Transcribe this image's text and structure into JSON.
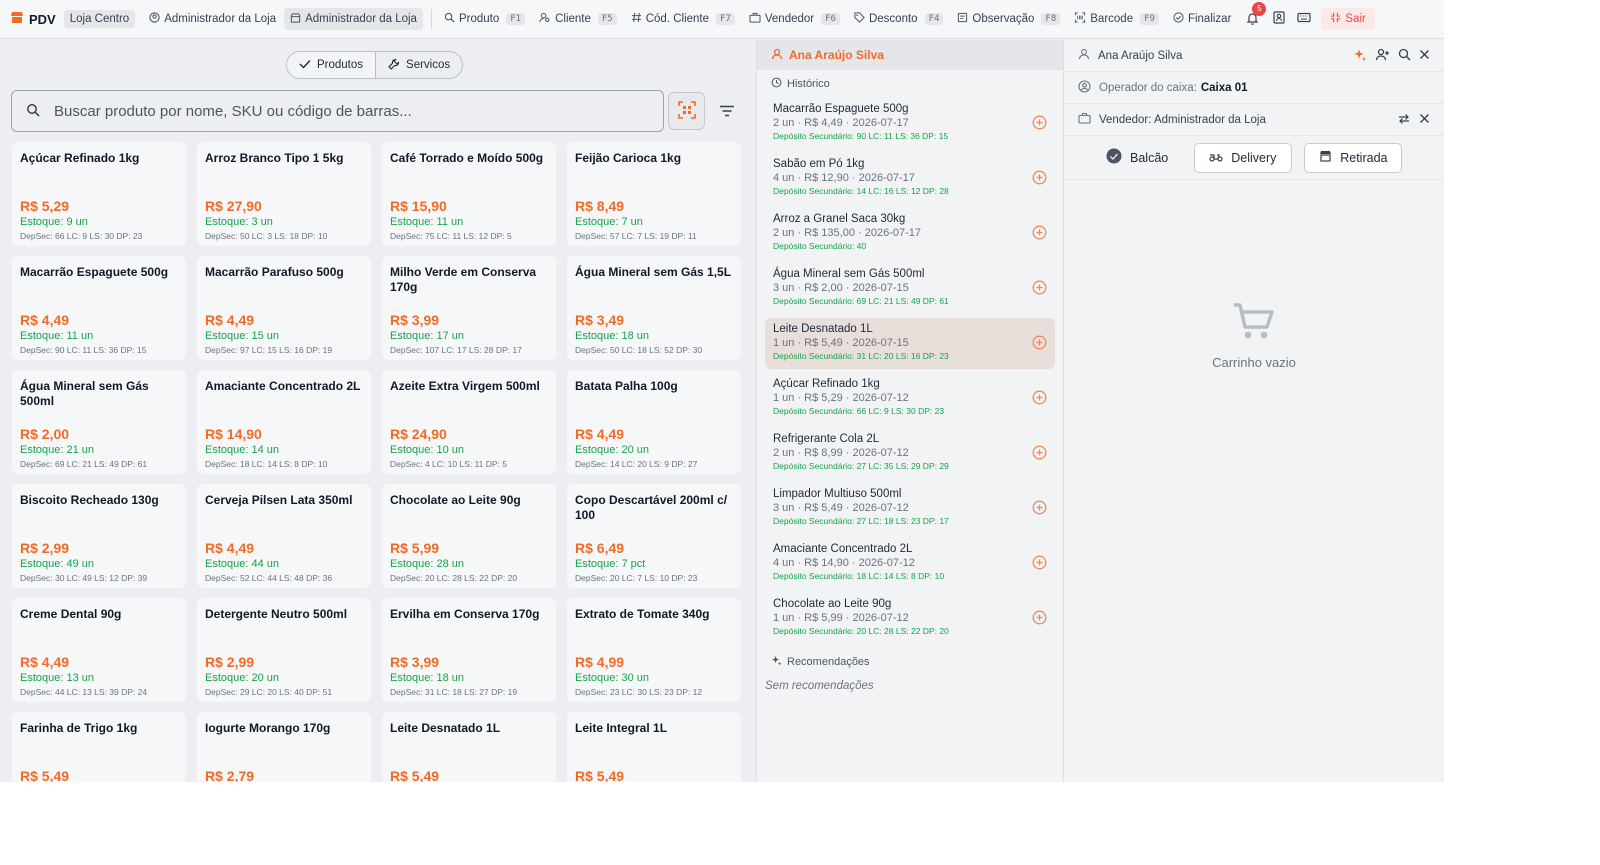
{
  "colors": {
    "accent": "#f06b26",
    "stock": "#16a34a",
    "danger": "#ef4444"
  },
  "topbar": {
    "brand": "PDV",
    "store": "Loja Centro",
    "items": [
      {
        "label": "Administrador da Loja",
        "icon": "user-circle-icon",
        "key": ""
      },
      {
        "label": "Administrador da Loja",
        "icon": "store-icon",
        "key": ""
      },
      {
        "label": "Produto",
        "icon": "search-icon",
        "key": "F1"
      },
      {
        "label": "Cliente",
        "icon": "user-search-icon",
        "key": "F5"
      },
      {
        "label": "Cód. Cliente",
        "icon": "hash-icon",
        "key": "F7"
      },
      {
        "label": "Vendedor",
        "icon": "briefcase-icon",
        "key": "F6"
      },
      {
        "label": "Desconto",
        "icon": "tag-icon",
        "key": "F4"
      },
      {
        "label": "Observação",
        "icon": "note-icon",
        "key": "F8"
      },
      {
        "label": "Barcode",
        "icon": "barcode-scan-icon",
        "key": "F9"
      },
      {
        "label": "Finalizar",
        "icon": "check-circle-icon",
        "key": ""
      }
    ],
    "notifications": "5",
    "exit_label": "Sair"
  },
  "tabs": {
    "products": "Produtos",
    "services": "Servicos"
  },
  "search": {
    "placeholder": "Buscar produto por nome, SKU ou código de barras..."
  },
  "products": [
    {
      "name": "Açúcar Refinado 1kg",
      "price": "R$ 5,29",
      "stock": "Estoque: 9 un",
      "dep": "DepSec: 66  LC: 9  LS: 30  DP: 23"
    },
    {
      "name": "Arroz Branco Tipo 1 5kg",
      "price": "R$ 27,90",
      "stock": "Estoque: 3 un",
      "dep": "DepSec: 50  LC: 3  LS: 18  DP: 10"
    },
    {
      "name": "Café Torrado e Moído 500g",
      "price": "R$ 15,90",
      "stock": "Estoque: 11 un",
      "dep": "DepSec: 75  LC: 11  LS: 12  DP: 5"
    },
    {
      "name": "Feijão Carioca 1kg",
      "price": "R$ 8,49",
      "stock": "Estoque: 7 un",
      "dep": "DepSec: 57  LC: 7  LS: 19  DP: 11"
    },
    {
      "name": "Macarrão Espaguete 500g",
      "price": "R$ 4,49",
      "stock": "Estoque: 11 un",
      "dep": "DepSec: 90  LC: 11  LS: 36  DP: 15"
    },
    {
      "name": "Macarrão Parafuso 500g",
      "price": "R$ 4,49",
      "stock": "Estoque: 15 un",
      "dep": "DepSec: 97  LC: 15  LS: 16  DP: 19"
    },
    {
      "name": "Milho Verde em Conserva 170g",
      "price": "R$ 3,99",
      "stock": "Estoque: 17 un",
      "dep": "DepSec: 107  LC: 17  LS: 28  DP: 17"
    },
    {
      "name": "Água Mineral sem Gás 1,5L",
      "price": "R$ 3,49",
      "stock": "Estoque: 18 un",
      "dep": "DepSec: 50  LC: 18  LS: 52  DP: 30"
    },
    {
      "name": "Água Mineral sem Gás 500ml",
      "price": "R$ 2,00",
      "stock": "Estoque: 21 un",
      "dep": "DepSec: 69  LC: 21  LS: 49  DP: 61"
    },
    {
      "name": "Amaciante Concentrado 2L",
      "price": "R$ 14,90",
      "stock": "Estoque: 14 un",
      "dep": "DepSec: 18  LC: 14  LS: 8  DP: 10"
    },
    {
      "name": "Azeite Extra Virgem 500ml",
      "price": "R$ 24,90",
      "stock": "Estoque: 10 un",
      "dep": "DepSec: 4  LC: 10  LS: 11  DP: 5"
    },
    {
      "name": "Batata Palha 100g",
      "price": "R$ 4,49",
      "stock": "Estoque: 20 un",
      "dep": "DepSec: 14  LC: 20  LS: 9  DP: 27"
    },
    {
      "name": "Biscoito Recheado 130g",
      "price": "R$ 2,99",
      "stock": "Estoque: 49 un",
      "dep": "DepSec: 30  LC: 49  LS: 12  DP: 39"
    },
    {
      "name": "Cerveja Pilsen Lata 350ml",
      "price": "R$ 4,49",
      "stock": "Estoque: 44 un",
      "dep": "DepSec: 52  LC: 44  LS: 48  DP: 36"
    },
    {
      "name": "Chocolate ao Leite 90g",
      "price": "R$ 5,99",
      "stock": "Estoque: 28 un",
      "dep": "DepSec: 20  LC: 28  LS: 22  DP: 20"
    },
    {
      "name": "Copo Descartável 200ml c/ 100",
      "price": "R$ 6,49",
      "stock": "Estoque: 7 pct",
      "dep": "DepSec: 20  LC: 7  LS: 10  DP: 23"
    },
    {
      "name": "Creme Dental 90g",
      "price": "R$ 4,49",
      "stock": "Estoque: 13 un",
      "dep": "DepSec: 44  LC: 13  LS: 39  DP: 24"
    },
    {
      "name": "Detergente Neutro 500ml",
      "price": "R$ 2,99",
      "stock": "Estoque: 20 un",
      "dep": "DepSec: 29  LC: 20  LS: 40  DP: 51"
    },
    {
      "name": "Ervilha em Conserva 170g",
      "price": "R$ 3,99",
      "stock": "Estoque: 18 un",
      "dep": "DepSec: 31  LC: 18  LS: 27  DP: 19"
    },
    {
      "name": "Extrato de Tomate 340g",
      "price": "R$ 4,99",
      "stock": "Estoque: 30 un",
      "dep": "DepSec: 23  LC: 30  LS: 23  DP: 12"
    },
    {
      "name": "Farinha de Trigo 1kg",
      "price": "R$ 5,49",
      "stock": "",
      "dep": ""
    },
    {
      "name": "Iogurte Morango 170g",
      "price": "R$ 2,79",
      "stock": "",
      "dep": ""
    },
    {
      "name": "Leite Desnatado 1L",
      "price": "R$ 5,49",
      "stock": "",
      "dep": ""
    },
    {
      "name": "Leite Integral 1L",
      "price": "R$ 5,49",
      "stock": "",
      "dep": ""
    }
  ],
  "customer_panel": {
    "name": "Ana Araújo Silva",
    "history_title": "Histórico",
    "history": [
      {
        "name": "Macarrão Espaguete 500g",
        "meta": "2 un · R$ 4,49 · 2026-07-17",
        "dep": "Depósito Secundário: 90  LC: 11  LS: 36  DP: 15"
      },
      {
        "name": "Sabão em Pó 1kg",
        "meta": "4 un · R$ 12,90 · 2026-07-17",
        "dep": "Depósito Secundário: 14  LC: 16  LS: 12  DP: 28"
      },
      {
        "name": "Arroz a Granel Saca 30kg",
        "meta": "2 un · R$ 135,00 · 2026-07-17",
        "dep": "Depósito Secundário: 40"
      },
      {
        "name": "Água Mineral sem Gás 500ml",
        "meta": "3 un · R$ 2,00 · 2026-07-15",
        "dep": "Depósito Secundário: 69  LC: 21  LS: 49  DP: 61"
      },
      {
        "name": "Leite Desnatado 1L",
        "meta": "1 un · R$ 5,49 · 2026-07-15",
        "dep": "Depósito Secundário: 31  LC: 20  LS: 16  DP: 23"
      },
      {
        "name": "Açúcar Refinado 1kg",
        "meta": "1 un · R$ 5,29 · 2026-07-12",
        "dep": "Depósito Secundário: 66  LC: 9  LS: 30  DP: 23"
      },
      {
        "name": "Refrigerante Cola 2L",
        "meta": "2 un · R$ 8,99 · 2026-07-12",
        "dep": "Depósito Secundário: 27  LC: 35  LS: 29  DP: 29"
      },
      {
        "name": "Limpador Multiuso 500ml",
        "meta": "3 un · R$ 5,49 · 2026-07-12",
        "dep": "Depósito Secundário: 27  LC: 18  LS: 23  DP: 17"
      },
      {
        "name": "Amaciante Concentrado 2L",
        "meta": "4 un · R$ 14,90 · 2026-07-12",
        "dep": "Depósito Secundário: 18  LC: 14  LS: 8  DP: 10"
      },
      {
        "name": "Chocolate ao Leite 90g",
        "meta": "1 un · R$ 5,99 · 2026-07-12",
        "dep": "Depósito Secundário: 20  LC: 28  LS: 22  DP: 20"
      }
    ],
    "recommendations_title": "Recomendações",
    "no_recommendations": "Sem recomendações"
  },
  "cart": {
    "customer": "Ana Araújo Silva",
    "operator_label": "Operador do caixa:",
    "operator_value": "Caixa 01",
    "seller": "Vendedor: Administrador da Loja",
    "modes": {
      "counter": "Balcão",
      "delivery": "Delivery",
      "pickup": "Retirada"
    },
    "empty": "Carrinho vazio"
  }
}
